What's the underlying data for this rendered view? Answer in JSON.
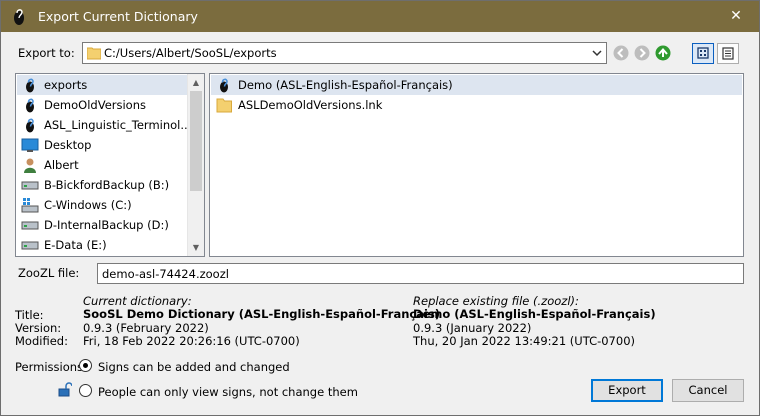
{
  "window": {
    "title": "Export Current Dictionary",
    "close_glyph": "✕"
  },
  "export_to": {
    "label": "Export to:",
    "path": "C:/Users/Albert/SooSL/exports",
    "icons": [
      "folder-icon",
      "back-icon",
      "forward-icon",
      "up-folder-icon",
      "icon-view-icon",
      "list-view-icon"
    ]
  },
  "places": [
    {
      "label": "exports",
      "icon": "soosl-icon",
      "selected": true
    },
    {
      "label": "DemoOldVersions",
      "icon": "soosl-icon"
    },
    {
      "label": "ASL_Linguistic_Terminol...",
      "icon": "soosl-icon"
    },
    {
      "label": "Desktop",
      "icon": "desktop-icon"
    },
    {
      "label": "Albert",
      "icon": "user-icon"
    },
    {
      "label": "B-BickfordBackup (B:)",
      "icon": "drive-icon"
    },
    {
      "label": "C-Windows (C:)",
      "icon": "windows-drive-icon"
    },
    {
      "label": "D-InternalBackup (D:)",
      "icon": "drive-icon"
    },
    {
      "label": "E-Data (E:)",
      "icon": "drive-icon"
    }
  ],
  "files": [
    {
      "label": "Demo (ASL-English-Español-Français)",
      "icon": "soosl-icon",
      "selected": true
    },
    {
      "label": "ASLDemoOldVersions.lnk",
      "icon": "folder-icon"
    }
  ],
  "zoozl": {
    "label": "ZooZL file:",
    "value": "demo-asl-74424.zoozl"
  },
  "fields": {
    "title_label": "Title:",
    "version_label": "Version:",
    "modified_label": "Modified:"
  },
  "current": {
    "heading": "Current dictionary:",
    "title": "SooSL Demo Dictionary (ASL-English-Español-Français)",
    "version": "0.9.3 (February 2022)",
    "modified": "Fri, 18 Feb 2022 20:26:16 (UTC-0700)"
  },
  "replace": {
    "heading": "Replace existing file (.zoozl):",
    "title": "Demo (ASL-English-Español-Français)",
    "version": "0.9.3 (January 2022)",
    "modified": "Thu, 20 Jan 2022 13:49:21 (UTC-0700)"
  },
  "permissions": {
    "label": "Permissions:",
    "options": [
      {
        "label": "Signs can be added and changed",
        "checked": true
      },
      {
        "label": "People can only view signs, not change them",
        "checked": false
      }
    ]
  },
  "buttons": {
    "export": "Export",
    "cancel": "Cancel"
  },
  "colors": {
    "titlebar": "#7b6c3e",
    "accent": "#0078d7",
    "selection": "#dde5f0"
  }
}
